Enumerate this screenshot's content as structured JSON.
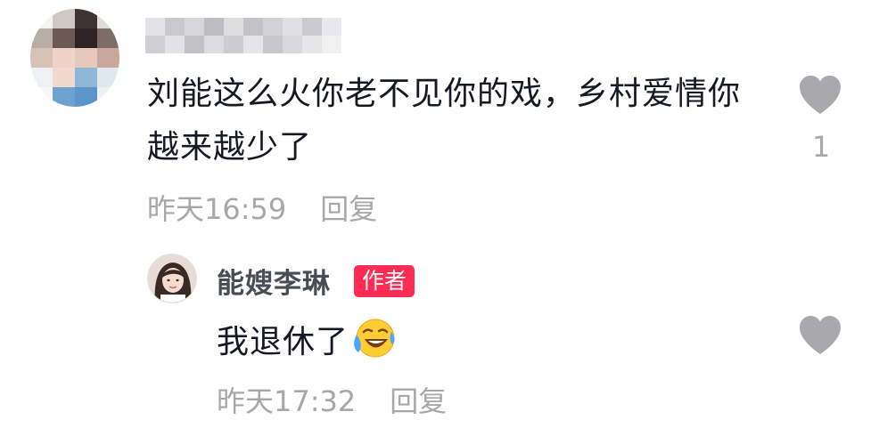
{
  "comment": {
    "text": "刘能这么火你老不见你的戏，乡村爱情你越来越少了",
    "time": "昨天16:59",
    "reply_label": "回复",
    "like_count": "1"
  },
  "reply": {
    "author": "能嫂李琳",
    "badge": "作者",
    "text": "我退休了",
    "time": "昨天17:32",
    "reply_label": "回复"
  },
  "icons": {
    "like": "heart-icon",
    "emoji": "laughing-crying-emoji-icon"
  },
  "colors": {
    "text": "#161823",
    "meta": "#a8a8ab",
    "heart": "#a9a9ac",
    "badge": "#fe2c55"
  }
}
